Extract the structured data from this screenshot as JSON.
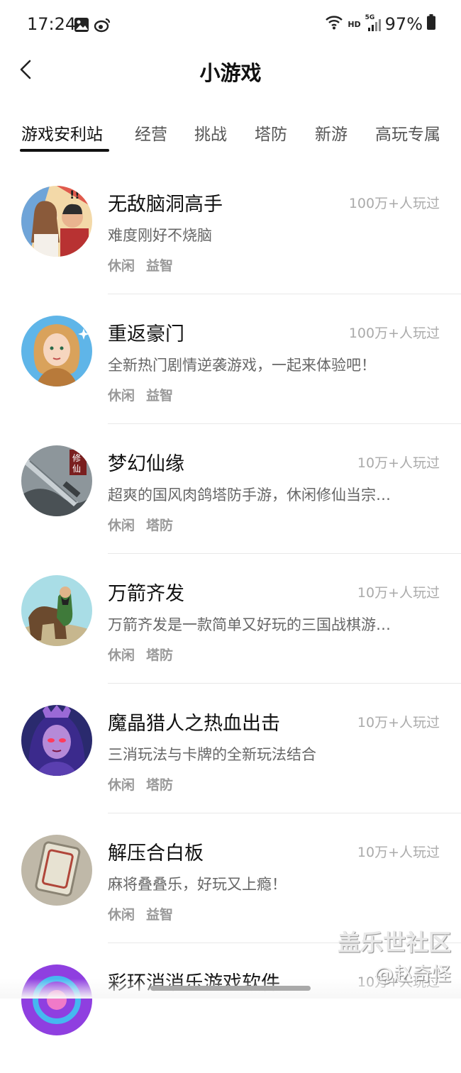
{
  "status": {
    "time": "17:24",
    "network": "HD",
    "signal": "5G",
    "battery": "97%"
  },
  "header": {
    "back_icon": "chevron-left-icon",
    "title": "小游戏"
  },
  "tabs": [
    {
      "label": "游戏安利站",
      "active": true
    },
    {
      "label": "经营",
      "active": false
    },
    {
      "label": "挑战",
      "active": false
    },
    {
      "label": "塔防",
      "active": false
    },
    {
      "label": "新游",
      "active": false
    },
    {
      "label": "高玩专属",
      "active": false
    }
  ],
  "games": [
    {
      "name": "无敌脑洞高手",
      "players": "100万+人玩过",
      "desc": "难度刚好不烧脑",
      "tags": [
        "休闲",
        "益智"
      ]
    },
    {
      "name": "重返豪门",
      "players": "100万+人玩过",
      "desc": "全新热门剧情逆袭游戏，一起来体验吧！",
      "tags": [
        "休闲",
        "益智"
      ]
    },
    {
      "name": "梦幻仙缘",
      "players": "10万+人玩过",
      "desc": "超爽的国风肉鸽塔防手游，休闲修仙当宗…",
      "tags": [
        "休闲",
        "塔防"
      ]
    },
    {
      "name": "万箭齐发",
      "players": "10万+人玩过",
      "desc": "万箭齐发是一款简单又好玩的三国战棋游…",
      "tags": [
        "休闲",
        "塔防"
      ]
    },
    {
      "name": "魔晶猎人之热血出击",
      "players": "10万+人玩过",
      "desc": "三消玩法与卡牌的全新玩法结合",
      "tags": [
        "休闲",
        "塔防"
      ]
    },
    {
      "name": "解压合白板",
      "players": "10万+人玩过",
      "desc": "麻将叠叠乐，好玩又上瘾！",
      "tags": [
        "休闲",
        "益智"
      ]
    },
    {
      "name": "彩环消消乐游戏软件",
      "players": "10万+人玩过",
      "desc": "",
      "tags": []
    }
  ],
  "watermark": {
    "line1": "盖乐世社区",
    "line2": "@赵奇怪"
  }
}
